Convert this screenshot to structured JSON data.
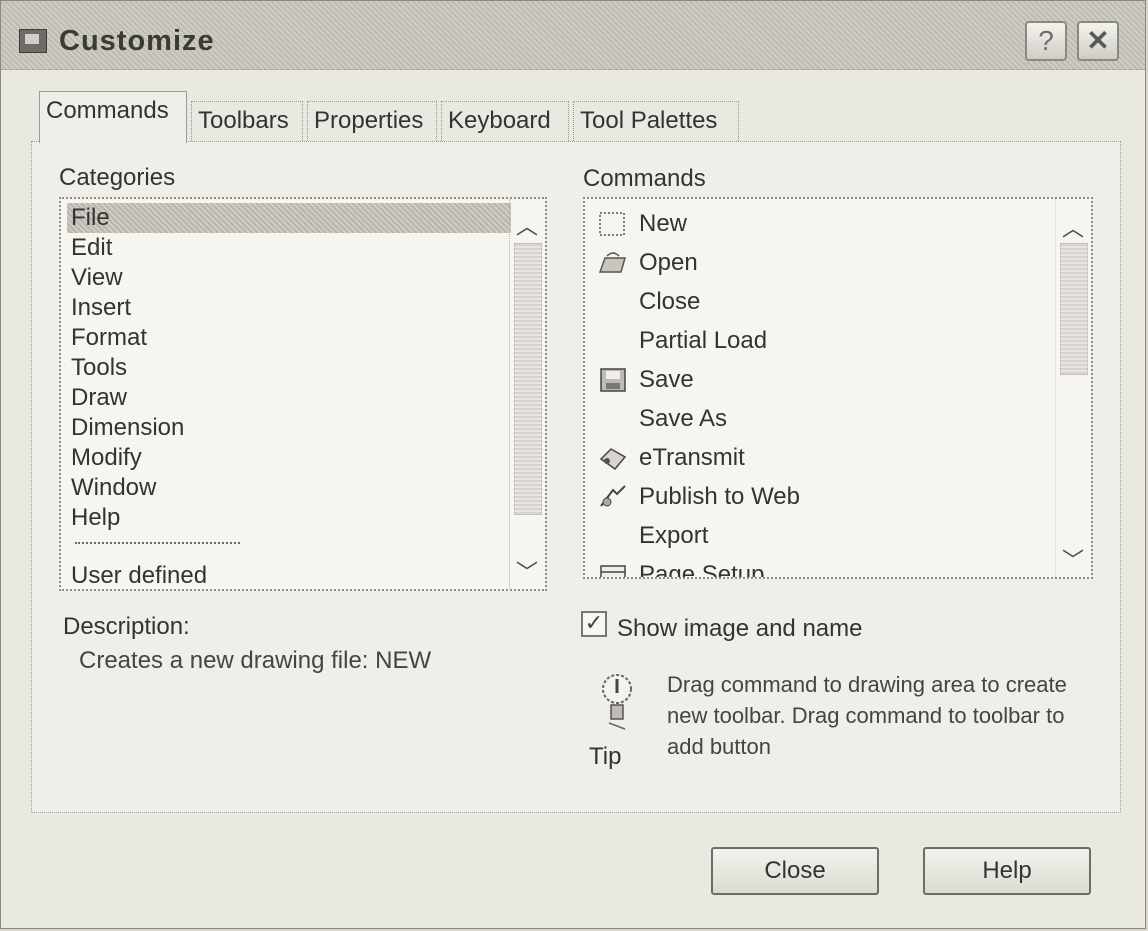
{
  "window": {
    "title": "Customize",
    "help_glyph": "?",
    "close_glyph": "✕"
  },
  "tabs": [
    {
      "label": "Commands",
      "active": true
    },
    {
      "label": "Toolbars",
      "active": false
    },
    {
      "label": "Properties",
      "active": false
    },
    {
      "label": "Keyboard",
      "active": false
    },
    {
      "label": "Tool Palettes",
      "active": false
    }
  ],
  "categories": {
    "label": "Categories",
    "items": [
      "File",
      "Edit",
      "View",
      "Insert",
      "Format",
      "Tools",
      "Draw",
      "Dimension",
      "Modify",
      "Window",
      "Help"
    ],
    "selected": "File",
    "extra_item": "User defined"
  },
  "commands": {
    "label": "Commands",
    "items": [
      {
        "label": "New",
        "icon": "new-document-icon"
      },
      {
        "label": "Open",
        "icon": "open-folder-icon"
      },
      {
        "label": "Close",
        "icon": ""
      },
      {
        "label": "Partial Load",
        "icon": ""
      },
      {
        "label": "Save",
        "icon": "save-disk-icon"
      },
      {
        "label": "Save As",
        "icon": ""
      },
      {
        "label": "eTransmit",
        "icon": "etransmit-icon"
      },
      {
        "label": "Publish to Web",
        "icon": "publish-web-icon"
      },
      {
        "label": "Export",
        "icon": ""
      },
      {
        "label": "Page Setup",
        "icon": "page-setup-icon"
      }
    ]
  },
  "description": {
    "label": "Description:",
    "value": "Creates a new drawing file:  NEW"
  },
  "show_image": {
    "label": "Show image and name",
    "checked": true
  },
  "tip": {
    "label": "Tip",
    "text": "Drag command to drawing area to create new toolbar. Drag command to toolbar to add button"
  },
  "buttons": {
    "close": "Close",
    "help": "Help"
  }
}
